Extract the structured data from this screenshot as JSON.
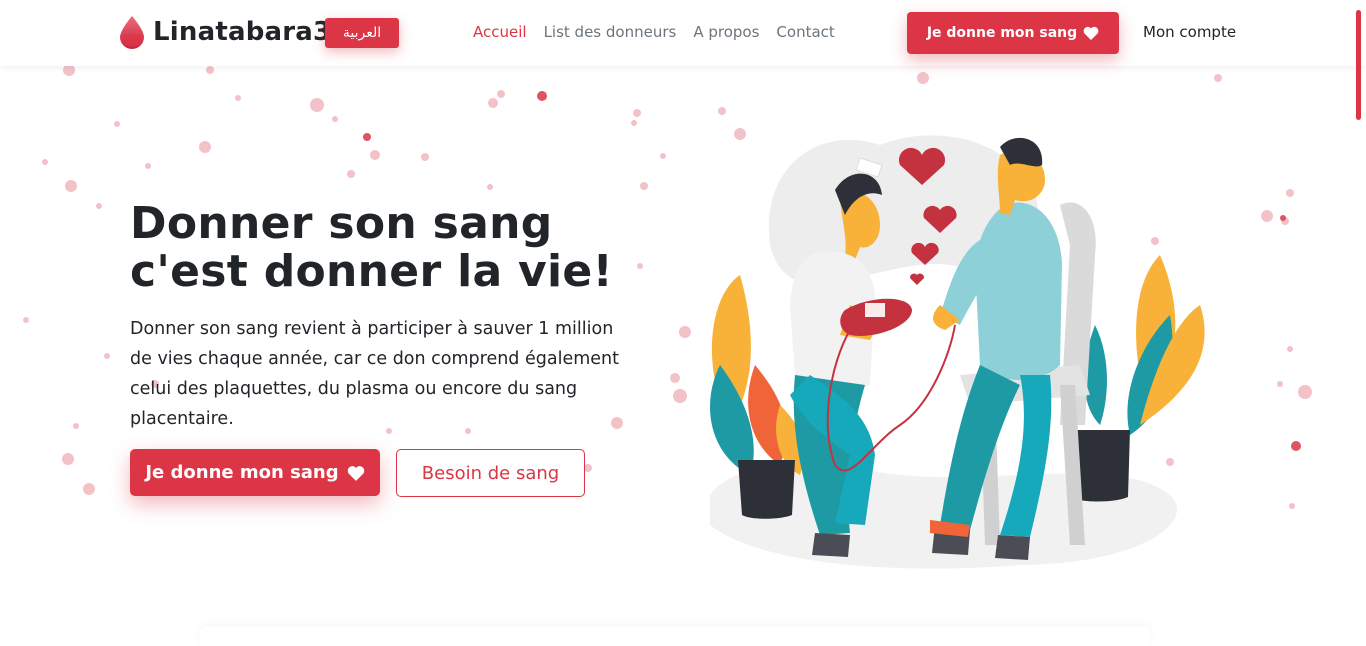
{
  "nav": {
    "brand": "Linatabara3",
    "lang_button": "العربية",
    "links": [
      "Accueil",
      "List des donneurs",
      "A propos",
      "Contact"
    ],
    "cta": "Je donne mon sang",
    "account": "Mon compte"
  },
  "hero": {
    "title": "Donner son sang c'est donner la vie!",
    "text": "Donner son sang revient à participer à sauver 1 million de vies chaque année, car ce don comprend également celui des plaquettes, du plasma ou encore du sang placentaire.",
    "primary_button": "Je donne mon sang",
    "secondary_button": "Besoin de sang"
  },
  "colors": {
    "accent": "#dc3545",
    "text": "#212529",
    "muted": "#6c757d"
  }
}
